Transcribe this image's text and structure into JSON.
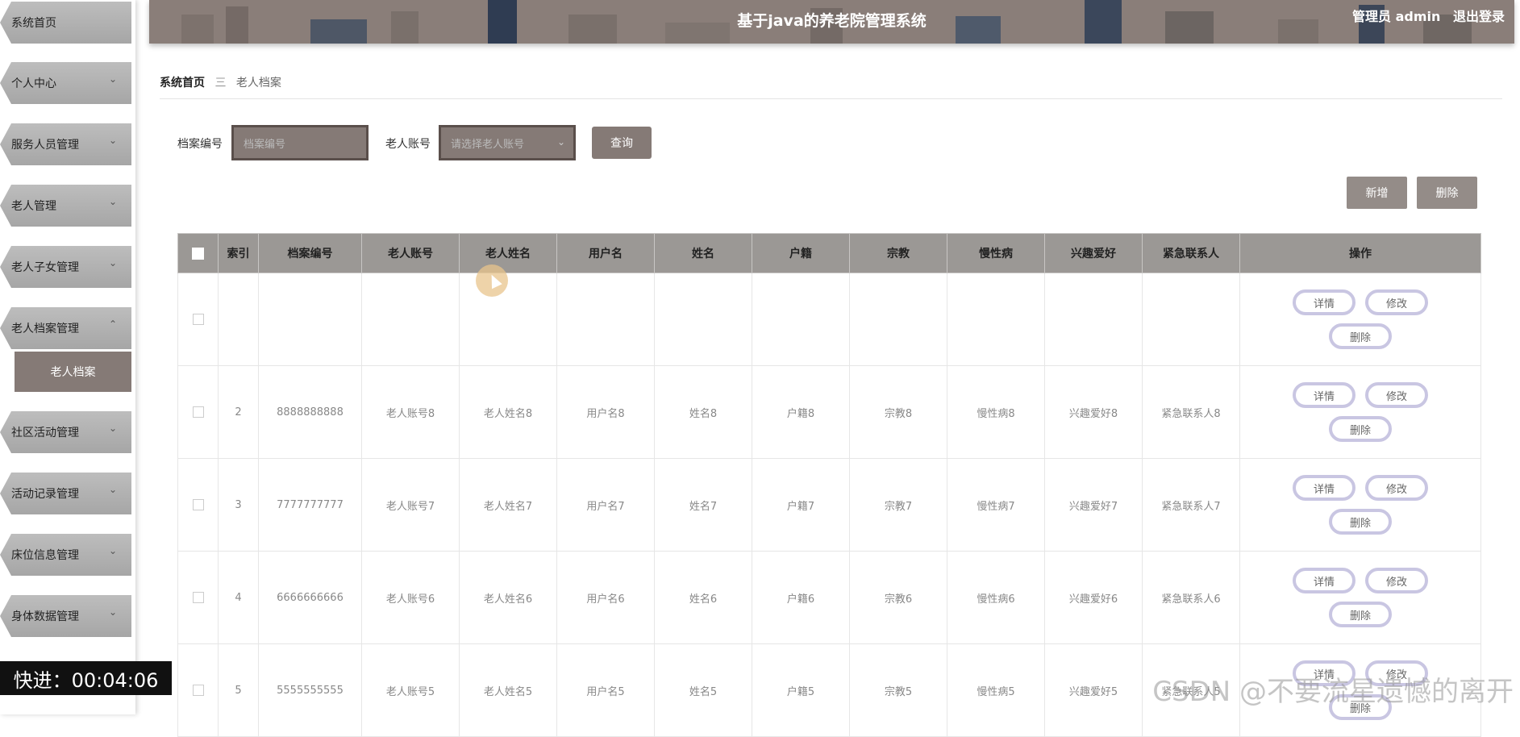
{
  "app": {
    "title": "基于java的养老院管理系统",
    "user": "管理员 admin",
    "logout": "退出登录"
  },
  "sidebar": {
    "items": [
      {
        "label": "系统首页",
        "chevron": ""
      },
      {
        "label": "个人中心",
        "chevron": "⌄"
      },
      {
        "label": "服务人员管理",
        "chevron": "⌄"
      },
      {
        "label": "老人管理",
        "chevron": "⌄"
      },
      {
        "label": "老人子女管理",
        "chevron": "⌄"
      },
      {
        "label": "老人档案管理",
        "chevron": "⌃"
      },
      {
        "label": "社区活动管理",
        "chevron": "⌄"
      },
      {
        "label": "活动记录管理",
        "chevron": "⌄"
      },
      {
        "label": "床位信息管理",
        "chevron": "⌄"
      },
      {
        "label": "身体数据管理",
        "chevron": "⌄"
      }
    ],
    "active_sub": "老人档案"
  },
  "breadcrumb": {
    "home": "系统首页",
    "separator": "三",
    "current": "老人档案"
  },
  "search": {
    "archive_label": "档案编号",
    "archive_placeholder": "档案编号",
    "account_label": "老人账号",
    "account_placeholder": "请选择老人账号",
    "query_button": "查询"
  },
  "actions": {
    "add": "新增",
    "delete": "删除"
  },
  "table": {
    "headers": [
      "索引",
      "档案编号",
      "老人账号",
      "老人姓名",
      "用户名",
      "姓名",
      "户籍",
      "宗教",
      "慢性病",
      "兴趣爱好",
      "紧急联系人",
      "操作"
    ],
    "row_buttons": {
      "detail": "详情",
      "edit": "修改",
      "delete": "删除"
    },
    "rows": [
      [
        "",
        "",
        "",
        "",
        "",
        "",
        "",
        "",
        "",
        "",
        ""
      ],
      [
        "2",
        "8888888888",
        "老人账号8",
        "老人姓名8",
        "用户名8",
        "姓名8",
        "户籍8",
        "宗教8",
        "慢性病8",
        "兴趣爱好8",
        "紧急联系人8"
      ],
      [
        "3",
        "7777777777",
        "老人账号7",
        "老人姓名7",
        "用户名7",
        "姓名7",
        "户籍7",
        "宗教7",
        "慢性病7",
        "兴趣爱好7",
        "紧急联系人7"
      ],
      [
        "4",
        "6666666666",
        "老人账号6",
        "老人姓名6",
        "用户名6",
        "姓名6",
        "户籍6",
        "宗教6",
        "慢性病6",
        "兴趣爱好6",
        "紧急联系人6"
      ],
      [
        "5",
        "5555555555",
        "老人账号5",
        "老人姓名5",
        "用户名5",
        "姓名5",
        "户籍5",
        "宗教5",
        "慢性病5",
        "兴趣爱好5",
        "紧急联系人5"
      ]
    ]
  },
  "overlay": {
    "fast_forward": "快进：00:04:06",
    "watermark": "CSDN @不要流星遗憾的离开"
  },
  "colors": {
    "header_bg": "#8a7e79",
    "accent": "#857a76",
    "table_header_bg": "#9b9895",
    "op_button_border": "#c9c6e2"
  }
}
